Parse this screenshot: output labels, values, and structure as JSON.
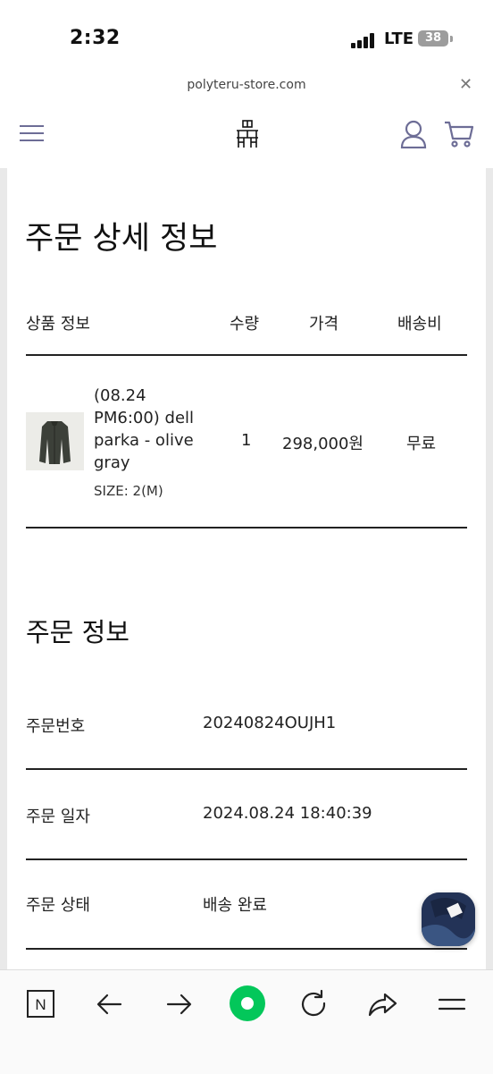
{
  "status_bar": {
    "time": "2:32",
    "network": "LTE",
    "battery": "38"
  },
  "browser": {
    "url": "polyteru-store.com",
    "close_icon": "close-icon"
  },
  "header": {
    "menu_icon": "hamburger-menu-icon",
    "logo": "store-logo",
    "account_icon": "user-icon",
    "cart_icon": "cart-icon",
    "accent_color": "#6d6d96"
  },
  "order_detail": {
    "title": "주문 상세 정보",
    "columns": {
      "product": "상품 정보",
      "quantity": "수량",
      "price": "가격",
      "shipping": "배송비"
    },
    "item": {
      "name_lines": [
        "(08.24",
        "PM6:00) dell",
        "parka - olive",
        "gray"
      ],
      "size": "SIZE: 2(M)",
      "quantity": "1",
      "price": "298,000원",
      "shipping": "무료"
    }
  },
  "order_info": {
    "title": "주문 정보",
    "rows": [
      {
        "label": "주문번호",
        "value": "20240824OUJH1"
      },
      {
        "label": "주문 일자",
        "value": "2024.08.24 18:40:39"
      },
      {
        "label": "주문 상태",
        "value": "배송 완료"
      }
    ]
  },
  "toolbar": {
    "items": [
      "naver-home-icon",
      "back-arrow-icon",
      "forward-arrow-icon",
      "green-circle-icon",
      "reload-icon",
      "share-icon",
      "menu-icon"
    ],
    "home_label": "N",
    "green_color": "#03c75a"
  }
}
